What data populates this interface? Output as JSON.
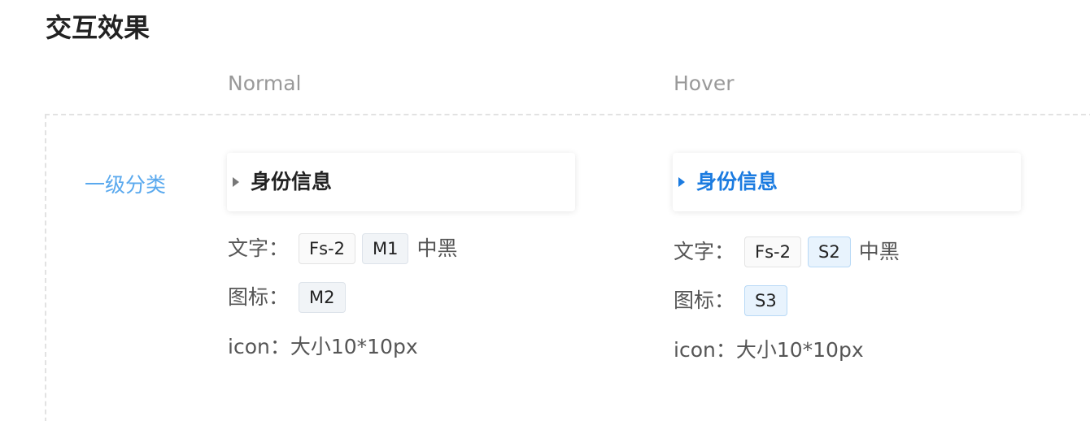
{
  "section": {
    "title": "交互效果"
  },
  "columns": {
    "normal": "Normal",
    "hover": "Hover"
  },
  "row": {
    "label": "一级分类"
  },
  "normal": {
    "card_text": "身份信息",
    "text_label": "文字：",
    "text_tags": [
      "Fs-2",
      "M1"
    ],
    "text_suffix": "中黑",
    "icon_label": "图标：",
    "icon_tag": "M2",
    "size_text": "icon：大小10*10px"
  },
  "hover": {
    "card_text": "身份信息",
    "text_label": "文字：",
    "text_tags": [
      "Fs-2",
      "S2"
    ],
    "text_suffix": "中黑",
    "icon_label": "图标：",
    "icon_tag": "S3",
    "size_text": "icon：大小10*10px"
  },
  "colors": {
    "row_label": "#5aa9ee",
    "hover_accent": "#1b7be0",
    "normal_text": "#222222",
    "normal_caret": "#777777"
  },
  "icons": {
    "normal_caret": "caret-right-icon",
    "hover_caret": "caret-right-icon"
  }
}
